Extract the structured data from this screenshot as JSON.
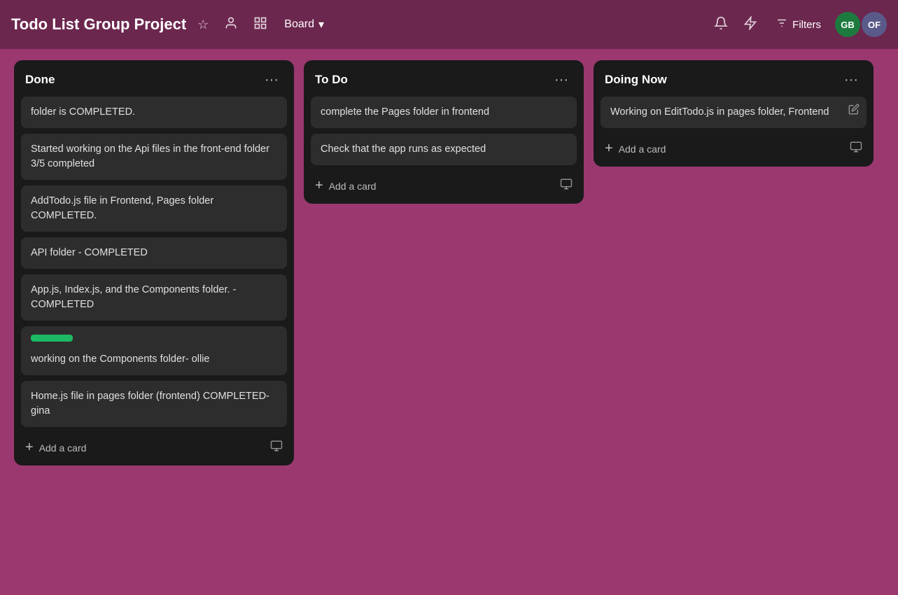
{
  "header": {
    "title": "Todo List Group Project",
    "star_icon": "☆",
    "person_icon": "👤",
    "grid_icon": "▦",
    "view_label": "Board",
    "chevron_icon": "⌄",
    "bell_icon": "🔔",
    "lightning_icon": "⚡",
    "filter_icon": "≡",
    "filters_label": "Filters",
    "avatar_gb": "GB",
    "avatar_of": "OF"
  },
  "columns": [
    {
      "id": "done",
      "title": "Done",
      "cards": [
        {
          "id": "d1",
          "text": "folder is COMPLETED.",
          "badge": null,
          "edit": false
        },
        {
          "id": "d2",
          "text": "Started working on the Api files in the front-end folder 3/5 completed",
          "badge": null,
          "edit": false
        },
        {
          "id": "d3",
          "text": "AddTodo.js file in Frontend, Pages folder COMPLETED.",
          "badge": null,
          "edit": false
        },
        {
          "id": "d4",
          "text": "API folder - COMPLETED",
          "badge": null,
          "edit": false
        },
        {
          "id": "d5",
          "text": "App.js, Index.js, and the Components folder. - COMPLETED",
          "badge": null,
          "edit": false
        },
        {
          "id": "d6",
          "text": "working on the Components folder- ollie",
          "badge": "green",
          "edit": false
        },
        {
          "id": "d7",
          "text": "Home.js file in pages folder (frontend) COMPLETED- gina",
          "badge": null,
          "edit": false
        }
      ],
      "add_label": "Add a card"
    },
    {
      "id": "todo",
      "title": "To Do",
      "cards": [
        {
          "id": "t1",
          "text": "complete the Pages folder in frontend",
          "badge": null,
          "edit": false
        },
        {
          "id": "t2",
          "text": "Check that the app runs as expected",
          "badge": null,
          "edit": false
        }
      ],
      "add_label": "Add a card"
    },
    {
      "id": "doing-now",
      "title": "Doing Now",
      "cards": [
        {
          "id": "dn1",
          "text": "Working on EditTodo.js in pages folder, Frontend",
          "badge": null,
          "edit": true
        }
      ],
      "add_label": "Add a card"
    }
  ]
}
